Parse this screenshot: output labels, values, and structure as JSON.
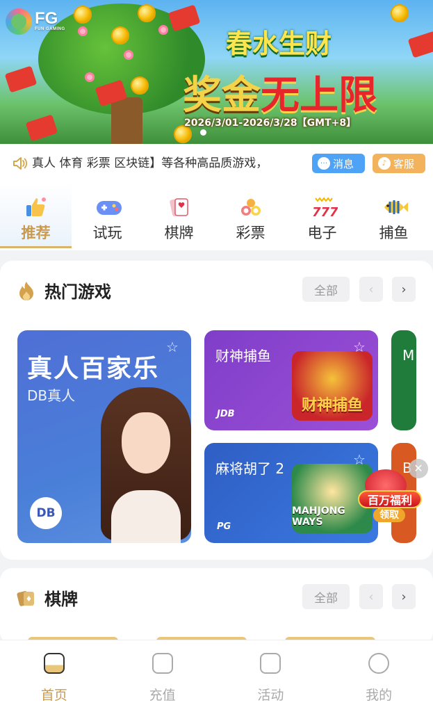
{
  "banner": {
    "logo_text": "FG",
    "logo_sub": "FUN GAMING",
    "title_line1": "春水生财",
    "title_line2_a": "奖金",
    "title_line2_b": "无上限",
    "date_range": "2026/3/01-2026/3/28【GMT+8】"
  },
  "notice": {
    "text": "真人 体育 彩票 区块链】等各种高品质游戏，",
    "message_label": "消息",
    "service_label": "客服"
  },
  "tabs": [
    {
      "label": "推荐",
      "icon": "thumbs-up-icon"
    },
    {
      "label": "试玩",
      "icon": "gamepad-icon"
    },
    {
      "label": "棋牌",
      "icon": "cards-icon"
    },
    {
      "label": "彩票",
      "icon": "lottery-balls-icon"
    },
    {
      "label": "电子",
      "icon": "slot-777-icon"
    },
    {
      "label": "捕鱼",
      "icon": "fish-icon"
    }
  ],
  "hot_games": {
    "title": "热门游戏",
    "all_label": "全部",
    "cards": [
      {
        "title": "真人百家乐",
        "provider": "DB真人",
        "badge": "DB"
      },
      {
        "title": "财神捕鱼",
        "brand": "JDB",
        "art_text": "财神捕鱼"
      },
      {
        "title": "麻将胡了 2",
        "brand": "PG",
        "art_text": "MAHJONG WAYS"
      },
      {
        "peek": "M"
      },
      {
        "peek": "B"
      }
    ]
  },
  "promo": {
    "text": "百万福利",
    "button": "领取"
  },
  "chess": {
    "title": "棋牌",
    "all_label": "全部"
  },
  "bottom_nav": [
    {
      "label": "首页",
      "icon": "home-icon"
    },
    {
      "label": "充值",
      "icon": "wallet-icon"
    },
    {
      "label": "活动",
      "icon": "gift-icon"
    },
    {
      "label": "我的",
      "icon": "user-icon"
    }
  ],
  "colors": {
    "accent_gold": "#c99a4e",
    "message_blue": "#4fa3f6",
    "service_orange": "#f2b35c"
  }
}
